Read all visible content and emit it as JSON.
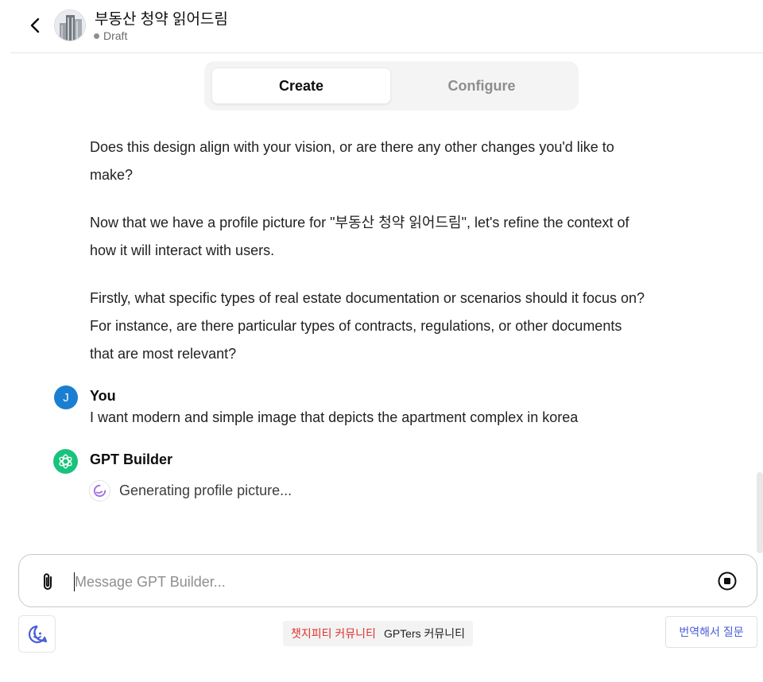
{
  "header": {
    "back_icon": "chevron-left-icon",
    "avatar_icon": "apartment-building-image",
    "title": "부동산 청약 읽어드림",
    "status": "Draft"
  },
  "tabs": [
    {
      "label": "Create",
      "active": true
    },
    {
      "label": "Configure",
      "active": false
    }
  ],
  "messages": {
    "assistant_paragraphs": [
      "Does this design align with your vision, or are there any other changes you'd like to make?",
      "Now that we have a profile picture for \"부동산 청약 읽어드림\", let's refine the context of how it will interact with users.",
      "Firstly, what specific types of real estate documentation or scenarios should it focus on? For instance, are there particular types of contracts, regulations, or other documents that are most relevant?"
    ],
    "user": {
      "avatar_letter": "J",
      "name": "You",
      "text": "I want modern and simple image that depicts the apartment complex in korea"
    },
    "builder": {
      "name": "GPT Builder",
      "status": "Generating profile picture..."
    }
  },
  "composer": {
    "placeholder": "Message GPT Builder...",
    "value": "",
    "attach_icon": "paperclip-icon",
    "stop_icon": "stop-icon"
  },
  "footer": {
    "widget_icon": "chat-bubble-icon",
    "community_primary": "챗지피티 커뮤니티",
    "community_secondary": "GPTers 커뮤니티",
    "translate_label": "번역해서 질문"
  },
  "colors": {
    "user_avatar": "#1a7fd1",
    "builder_avatar": "#19c37d",
    "community_primary": "#e0312b",
    "translate": "#4a5ed8"
  }
}
